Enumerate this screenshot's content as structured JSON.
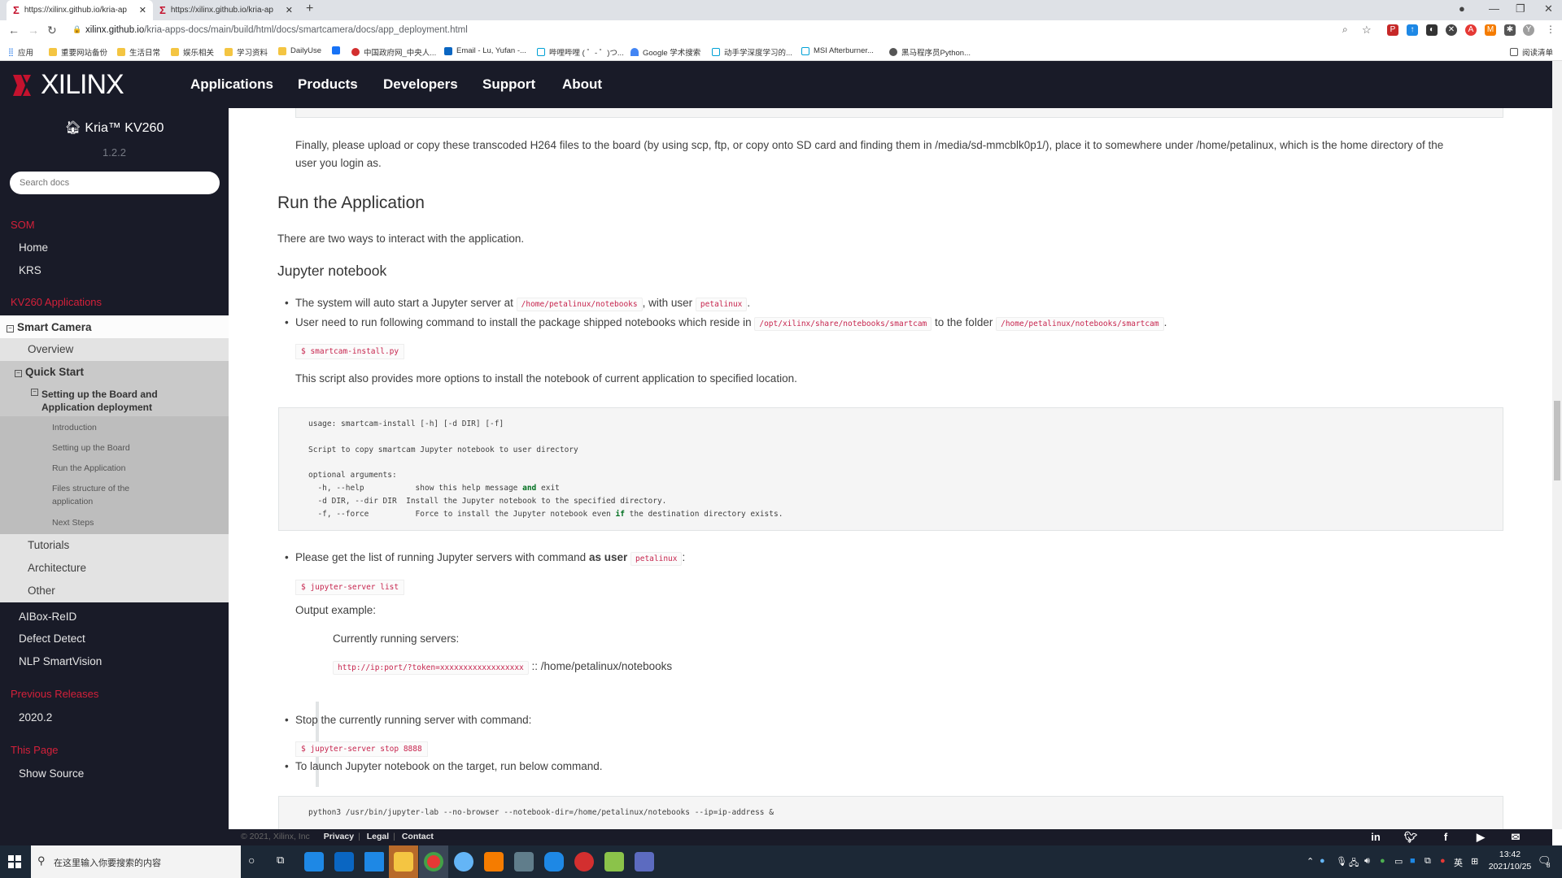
{
  "browser": {
    "tabs": [
      {
        "title": "https://xilinx.github.io/kria-ap",
        "active": true
      },
      {
        "title": "https://xilinx.github.io/kria-ap",
        "active": false
      }
    ],
    "new_tab": "+",
    "url_host": "xilinx.github.io",
    "url_path": "/kria-apps-docs/main/build/html/docs/smartcamera/docs/app_deployment.html",
    "bookmarks": [
      "应用",
      "重要网站备份",
      "生活日常",
      "娱乐相关",
      "学习资料",
      "DailyUse",
      "",
      "中国政府网_中央人...",
      "Email - Lu, Yufan -...",
      "哔哩哔哩 ( ゜- ゜)つ...",
      "Google 学术搜索",
      "动手学深度学习的...",
      "MSI Afterburner...",
      "黑马程序员Python..."
    ],
    "reading_list": "阅读清单"
  },
  "site": {
    "logo_text": "XILINX",
    "nav": [
      "Applications",
      "Products",
      "Developers",
      "Support",
      "About"
    ]
  },
  "sidebar": {
    "title": "Kria™ KV260",
    "version": "1.2.2",
    "search_placeholder": "Search docs",
    "captions": {
      "som": "SOM",
      "kv260": "KV260 Applications",
      "previous": "Previous Releases",
      "this_page": "This Page"
    },
    "som_links": [
      "Home",
      "KRS"
    ],
    "tree": {
      "smart_camera": "Smart Camera",
      "overview": "Overview",
      "quick_start": "Quick Start",
      "setup_deploy": "Setting up the Board and Application deployment",
      "sub": [
        "Introduction",
        "Setting up the Board",
        "Run the Application",
        "Files structure of the application",
        "Next Steps"
      ],
      "tutorials": "Tutorials",
      "architecture": "Architecture",
      "other": "Other"
    },
    "apps": [
      "AIBox-ReID",
      "Defect Detect",
      "NLP SmartVision"
    ],
    "previous": [
      "2020.2"
    ],
    "this_page": [
      "Show Source"
    ]
  },
  "content": {
    "intro_para_1": "Finally, please upload or copy these transcoded H264 files to the board (by using scp, ftp, or copy onto SD card and finding them in /media/sd-mmcblk0p1/), place it to somewhere under /home/petalinux, which is the home directory of the",
    "intro_para_2": "user you login as.",
    "h2": "Run the Application",
    "two_ways": "There are two ways to interact with the application.",
    "h3": "Jupyter notebook",
    "b1_pre": "The system will auto start a Jupyter server at",
    "b1_code1": "/home/petalinux/notebooks",
    "b1_mid": ", with user",
    "b1_code2": "petalinux",
    "b1_end": ".",
    "b2_pre": "User need to run following command to install the package shipped notebooks which reside in",
    "b2_code1": "/opt/xilinx/share/notebooks/smartcam",
    "b2_mid": "to the folder",
    "b2_code2": "/home/petalinux/notebooks/smartcam",
    "b2_end": ".",
    "cmd_install": "$ smartcam-install.py",
    "script_note": "This script also provides more options to install the notebook of current application to specified location.",
    "usage_block": {
      "line1": "usage: smartcam-install [-h] [-d DIR] [-f]",
      "line2": "Script to copy smartcam Jupyter notebook to user directory",
      "line3": "optional arguments:",
      "h_flag": "  -h, --help           show this help message ",
      "h_kw": "and",
      "h_end": " exit",
      "d_flag": "  -d DIR, --dir DIR  Install the Jupyter notebook to the specified directory.",
      "f_flag": "  -f, --force          Force to install the Jupyter notebook even ",
      "f_kw": "if",
      "f_end": " the destination directory exists."
    },
    "b3_pre": "Please get the list of running Jupyter servers with command",
    "b3_bold": "as user",
    "b3_code": "petalinux",
    "b3_end": ":",
    "cmd_list": "$ jupyter-server list",
    "output_example": "Output example:",
    "running_servers": "Currently running servers:",
    "server_url": "http://ip:port/?token=xxxxxxxxxxxxxxxxxx",
    "server_path": ":: /home/petalinux/notebooks",
    "b4": "Stop the currently running server with command:",
    "cmd_stop": "$ jupyter-server stop 8888",
    "b5": "To launch Jupyter notebook on the target, run below command.",
    "launch_cmd": "python3 /usr/bin/jupyter-lab --no-browser --notebook-dir=/home/petalinux/notebooks --ip=ip-address &"
  },
  "footer": {
    "copyright": "© 2021, Xilinx, Inc",
    "links": [
      "Privacy",
      "Legal",
      "Contact"
    ],
    "social": [
      "linkedin",
      "twitter",
      "facebook",
      "youtube",
      "email"
    ]
  },
  "taskbar": {
    "search_placeholder": "在这里输入你要搜索的内容",
    "ime": "英",
    "time": "13:42",
    "date": "2021/10/25",
    "notifications": "8"
  }
}
